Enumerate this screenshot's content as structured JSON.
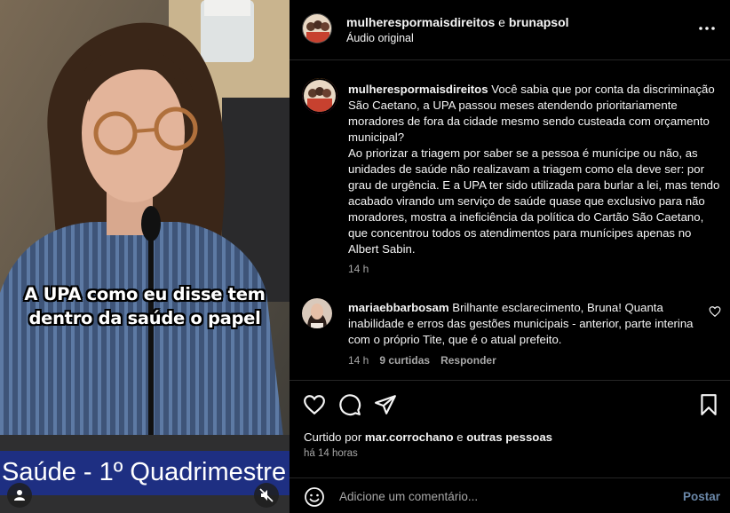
{
  "media": {
    "caption_line1": "A UPA como eu disse tem",
    "caption_line2": "dentro da saúde o papel",
    "lower_third": "Saúde - 1º Quadrimestre",
    "icons": [
      "user-icon",
      "muted-speaker-icon"
    ]
  },
  "header": {
    "account1": "mulherespormaisdireitos",
    "connector": " e ",
    "account2": "brunapsol",
    "audio": "Áudio original"
  },
  "post": {
    "author": "mulherespormaisdireitos",
    "body": "Você sabia que por conta da discriminação São Caetano, a UPA passou meses atendendo prioritariamente moradores de fora da cidade mesmo sendo custeada com orçamento municipal?\nAo priorizar a triagem por saber se a pessoa é munícipe ou não, as unidades de saúde não realizavam a triagem como ela deve ser: por grau de urgência. E a UPA ter sido utilizada para burlar a lei, mas tendo acabado virando um serviço de saúde quase que exclusivo para não moradores, mostra a ineficiência da política do Cartão São Caetano, que concentrou todos os atendimentos para munícipes apenas no Albert Sabin.",
    "time": "14 h"
  },
  "comment": {
    "author": "mariaebbarbosam",
    "body": "Brilhante esclarecimento, Bruna! Quanta inabilidade e erros das gestões municipais - anterior, parte interina com o próprio Tite, que é o atual prefeito.",
    "time": "14 h",
    "likes": "9 curtidas",
    "reply": "Responder"
  },
  "actions": {
    "liked_prefix": "Curtido por ",
    "liked_user": "mar.corrochano",
    "liked_mid": " e ",
    "liked_others": "outras pessoas",
    "ago": "há 14 horas"
  },
  "add_comment": {
    "placeholder": "Adicione um comentário...",
    "post_label": "Postar"
  },
  "colors": {
    "background": "#000000",
    "divider": "#262626",
    "secondary_text": "#a8a8a8",
    "post_button": "#6a87a8",
    "lower_third": "#1e2f82"
  }
}
